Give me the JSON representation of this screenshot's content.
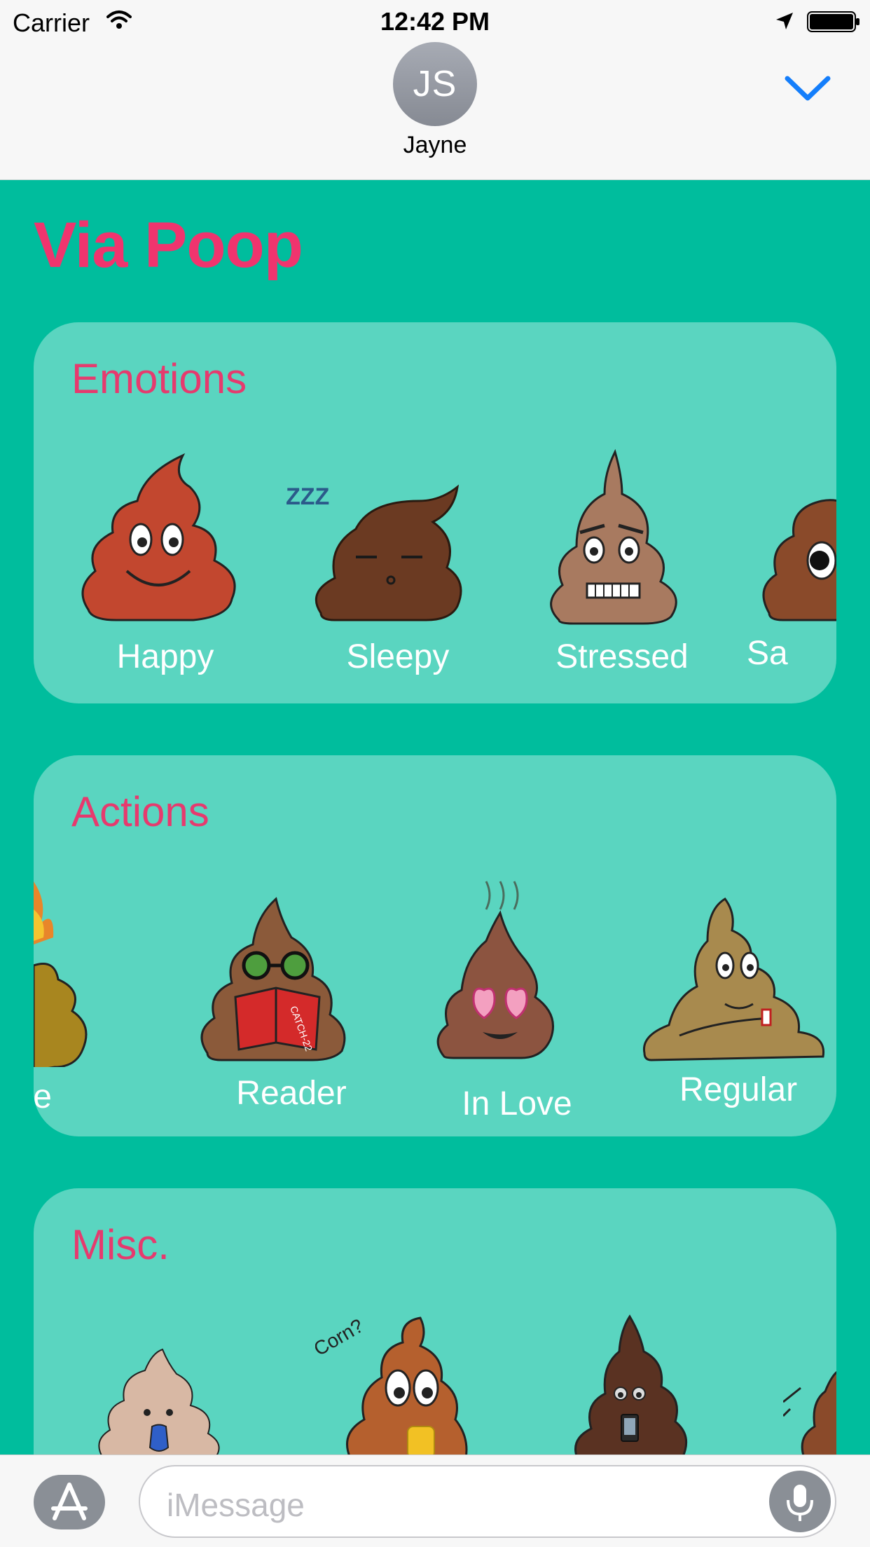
{
  "status_bar": {
    "carrier": "Carrier",
    "time": "12:42 PM"
  },
  "conversation": {
    "initials": "JS",
    "name": "Jayne"
  },
  "app": {
    "title": "Via Poop"
  },
  "categories": [
    {
      "title": "Emotions",
      "stickers": [
        "Happy",
        "Sleepy",
        "Stressed",
        "Sa"
      ]
    },
    {
      "title": "Actions",
      "stickers": [
        "re",
        "Reader",
        "In Love",
        "Regular"
      ]
    },
    {
      "title": "Misc.",
      "stickers": []
    }
  ],
  "sticker_annotations": {
    "book_cover": "CATCH-22",
    "corn_note": "Corn?",
    "sleep": "ZZZ"
  },
  "input_bar": {
    "placeholder": "iMessage"
  },
  "icons": {
    "wifi": "wifi-icon",
    "location": "location-arrow-icon",
    "battery": "battery-icon",
    "collapse": "chevron-down-icon",
    "app_store": "app-store-icon",
    "mic": "microphone-icon"
  },
  "colors": {
    "background": "#00BD9D",
    "card": "#5AD5C0",
    "title_pink": "#F0346E",
    "accent_blue": "#147EFB"
  }
}
